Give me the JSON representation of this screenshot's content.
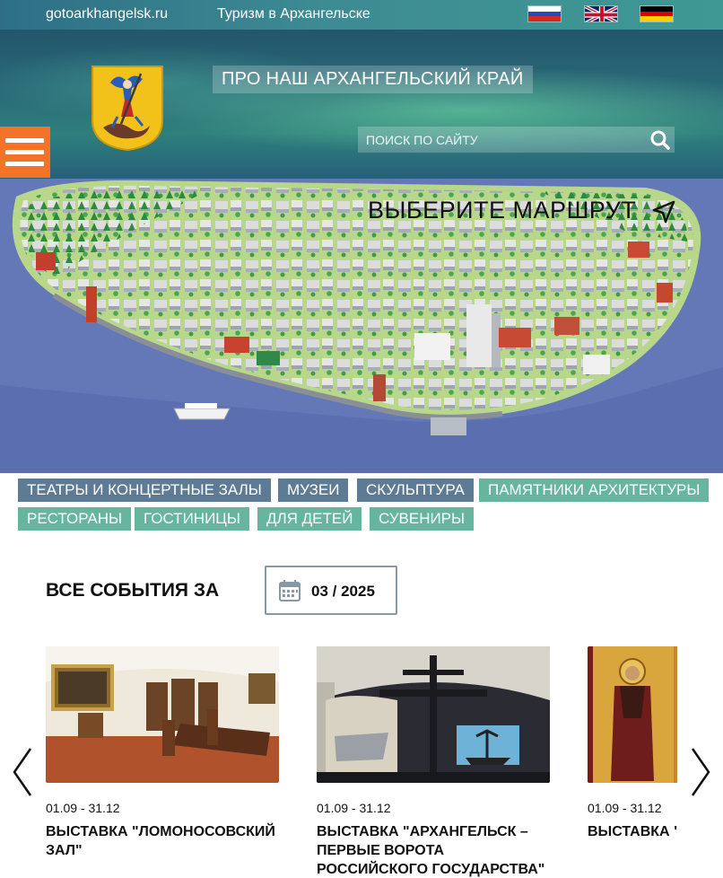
{
  "topbar": {
    "site": "gotoarkhangelsk.ru",
    "tagline": "Туризм в Архангельске",
    "languages": [
      "ru-flag-icon",
      "en-flag-icon",
      "de-flag-icon"
    ]
  },
  "header": {
    "title": "ПРО НАШ АРХАНГЕЛЬСКИЙ КРАЙ",
    "search_placeholder": "ПОИСК ПО САЙТУ",
    "menu_icon": "hamburger-icon",
    "accent_color": "#f37328"
  },
  "hero": {
    "route_title": "ВЫБЕРИТЕ МАРШРУТ",
    "route_icon": "navigation-arrow-icon"
  },
  "categories": {
    "row1": [
      {
        "label": "ТЕАТРЫ И КОНЦЕРТНЫЕ ЗАЛЫ",
        "color": "#5e7b96"
      },
      {
        "label": "МУЗЕИ",
        "color": "#5e7b96"
      },
      {
        "label": "СКУЛЬПТУРА",
        "color": "#5e7b96"
      },
      {
        "label": "ПАМЯТНИКИ АРХИТЕКТУРЫ",
        "color": "#66b59f"
      }
    ],
    "row2": [
      {
        "label": "РЕСТОРАНЫ",
        "color": "#66b59f"
      },
      {
        "label": "ГОСТИНИЦЫ",
        "color": "#66b59f"
      },
      {
        "label": "ДЛЯ ДЕТЕЙ",
        "color": "#66b59f"
      },
      {
        "label": "СУВЕНИРЫ",
        "color": "#66b59f"
      }
    ]
  },
  "events": {
    "heading": "ВСЕ СОБЫТИЯ ЗА",
    "selected_period": "03 / 2025",
    "calendar_icon": "calendar-icon",
    "items": [
      {
        "date": "01.09 - 31.12",
        "title": "Выставка \"Ломоносовский зал\""
      },
      {
        "date": "01.09 - 31.12",
        "title": "Выставка \"Архангельск – первые ворота Российского государства\""
      },
      {
        "date": "01.09 - 31.12",
        "title": "Выставка \" искусство"
      }
    ]
  }
}
